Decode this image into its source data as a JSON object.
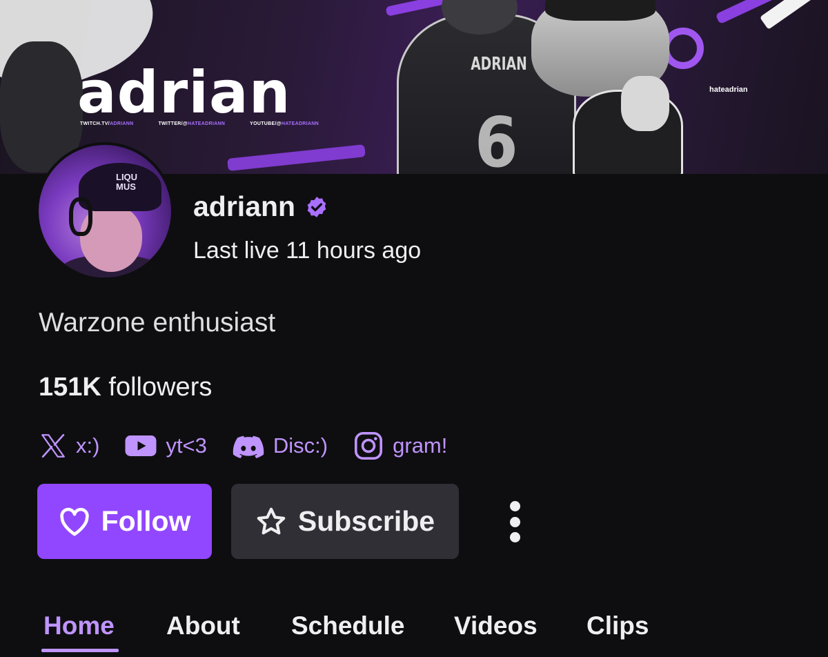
{
  "banner": {
    "title": "adrian",
    "links": [
      {
        "prefix": "TWITCH.TV/",
        "handle": "ADRIANN"
      },
      {
        "prefix": "TWITTER/@",
        "handle": "HATEADRIANN"
      },
      {
        "prefix": "YOUTUBE/@",
        "handle": "HATEADRIANN"
      }
    ],
    "handle": "hateadrian",
    "jersey_name": "ADRIAN",
    "jersey_number": "6",
    "cap_text_line1": "LIQU",
    "cap_text_line2": "MUS"
  },
  "channel": {
    "name": "adriann",
    "verified_icon": "verified-badge-icon",
    "last_live": "Last live 11 hours ago",
    "bio": "Warzone enthusiast",
    "followers_count": "151K",
    "followers_label": "followers"
  },
  "socials": [
    {
      "icon": "x-icon",
      "label": "x:)"
    },
    {
      "icon": "youtube-icon",
      "label": "yt<3"
    },
    {
      "icon": "discord-icon",
      "label": "Disc:)"
    },
    {
      "icon": "instagram-icon",
      "label": "gram!"
    }
  ],
  "actions": {
    "follow_label": "Follow",
    "follow_icon": "heart-icon",
    "subscribe_label": "Subscribe",
    "subscribe_icon": "star-icon",
    "more_icon": "more-vertical-icon"
  },
  "tabs": [
    {
      "label": "Home",
      "active": true
    },
    {
      "label": "About",
      "active": false
    },
    {
      "label": "Schedule",
      "active": false
    },
    {
      "label": "Videos",
      "active": false
    },
    {
      "label": "Clips",
      "active": false
    }
  ],
  "colors": {
    "background": "#0e0e10",
    "accent": "#9147ff",
    "accent_light": "#bf94ff",
    "secondary_button": "#2f2f35",
    "text": "#efeff1"
  }
}
